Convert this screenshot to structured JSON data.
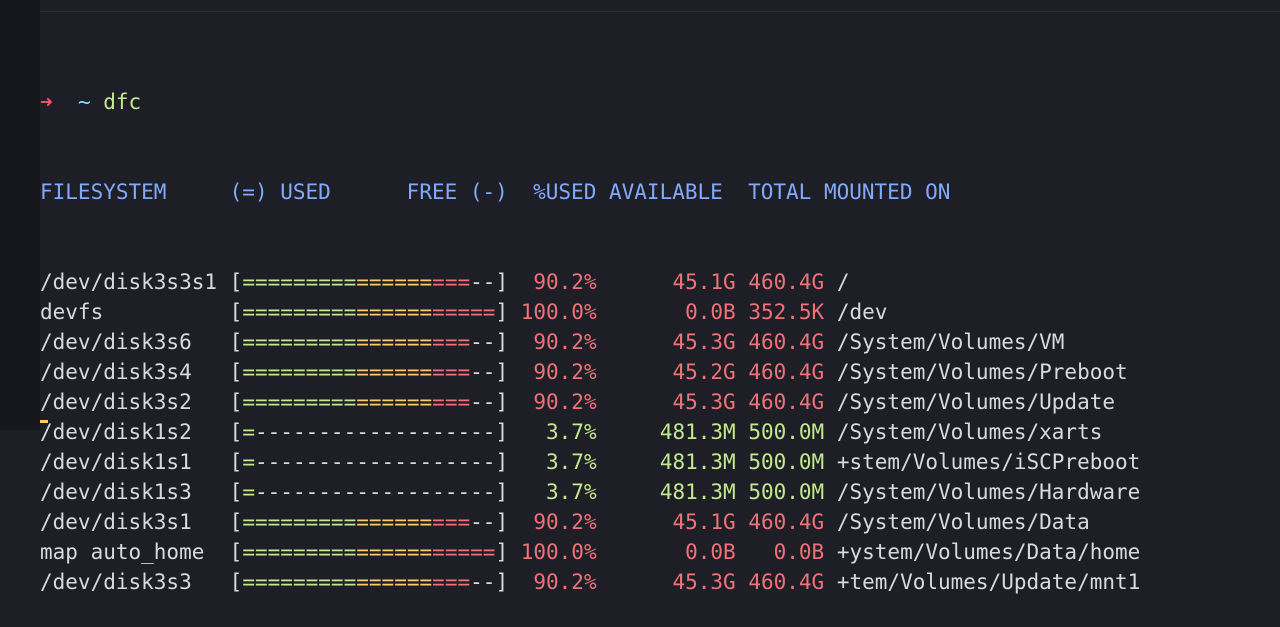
{
  "prompt": {
    "symbol": "➜",
    "cwd": "~",
    "command": "dfc"
  },
  "headers": [
    "FILESYSTEM",
    "(=) USED",
    "FREE (-)",
    "%USED",
    "AVAILABLE",
    "TOTAL",
    "MOUNTED ON"
  ],
  "rows": [
    {
      "fs": "/dev/disk3s3s1",
      "used_pct": 90.2,
      "pct": "90.2%",
      "avail": "45.1G",
      "total": "460.4G",
      "mount": "/"
    },
    {
      "fs": "devfs",
      "used_pct": 100.0,
      "pct": "100.0%",
      "avail": "0.0B",
      "total": "352.5K",
      "mount": "/dev"
    },
    {
      "fs": "/dev/disk3s6",
      "used_pct": 90.2,
      "pct": "90.2%",
      "avail": "45.3G",
      "total": "460.4G",
      "mount": "/System/Volumes/VM"
    },
    {
      "fs": "/dev/disk3s4",
      "used_pct": 90.2,
      "pct": "90.2%",
      "avail": "45.2G",
      "total": "460.4G",
      "mount": "/System/Volumes/Preboot"
    },
    {
      "fs": "/dev/disk3s2",
      "used_pct": 90.2,
      "pct": "90.2%",
      "avail": "45.3G",
      "total": "460.4G",
      "mount": "/System/Volumes/Update"
    },
    {
      "fs": "/dev/disk1s2",
      "used_pct": 3.7,
      "pct": "3.7%",
      "avail": "481.3M",
      "total": "500.0M",
      "mount": "/System/Volumes/xarts"
    },
    {
      "fs": "/dev/disk1s1",
      "used_pct": 3.7,
      "pct": "3.7%",
      "avail": "481.3M",
      "total": "500.0M",
      "mount": "+stem/Volumes/iSCPreboot"
    },
    {
      "fs": "/dev/disk1s3",
      "used_pct": 3.7,
      "pct": "3.7%",
      "avail": "481.3M",
      "total": "500.0M",
      "mount": "/System/Volumes/Hardware"
    },
    {
      "fs": "/dev/disk3s1",
      "used_pct": 90.2,
      "pct": "90.2%",
      "avail": "45.1G",
      "total": "460.4G",
      "mount": "/System/Volumes/Data"
    },
    {
      "fs": "map auto_home",
      "used_pct": 100.0,
      "pct": "100.0%",
      "avail": "0.0B",
      "total": "0.0B",
      "mount": "+ystem/Volumes/Data/home"
    },
    {
      "fs": "/dev/disk3s3",
      "used_pct": 90.2,
      "pct": "90.2%",
      "avail": "45.3G",
      "total": "460.4G",
      "mount": "+tem/Volumes/Update/mnt1"
    }
  ],
  "colors": {
    "background": "#1e1f26",
    "header": "#82aaff",
    "high": "#f07178",
    "low": "#c3e88d",
    "mid": "#ffcb6b",
    "prompt_arrow": "#ff5370"
  }
}
